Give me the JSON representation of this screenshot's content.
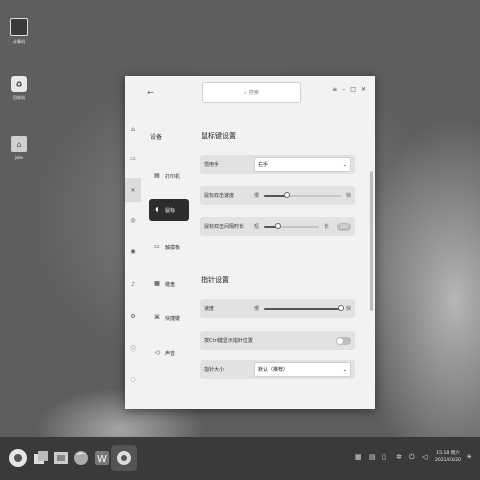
{
  "desktop": {
    "icons": [
      {
        "name": "computer",
        "label": "计算机"
      },
      {
        "name": "trash",
        "label": "回收站"
      },
      {
        "name": "home",
        "label": "jake"
      }
    ]
  },
  "window": {
    "back_icon": "←",
    "search_placeholder": "搜索",
    "controls": {
      "menu": "≡",
      "minimize": "–",
      "maximize": "□",
      "close": "✕"
    },
    "rail_icons": [
      "home-icon",
      "display-icon",
      "tool-icon",
      "globe-icon",
      "user-icon",
      "bell-icon",
      "gear-icon",
      "info-icon"
    ],
    "category_header": "设备",
    "categories": [
      {
        "label": "打印机",
        "icon": "printer-icon",
        "glyph": "▤"
      },
      {
        "label": "鼠标",
        "icon": "mouse-icon",
        "glyph": "◖",
        "active": true
      },
      {
        "label": "触摸板",
        "icon": "touchpad-icon",
        "glyph": "▭"
      },
      {
        "label": "键盘",
        "icon": "keyboard-icon",
        "glyph": "▦"
      },
      {
        "label": "快捷键",
        "icon": "shortcut-icon",
        "glyph": "⌘"
      },
      {
        "label": "声音",
        "icon": "sound-icon",
        "glyph": "◁"
      }
    ],
    "mouse_section": {
      "title": "鼠标键设置",
      "handedness_label": "惯用手",
      "handedness_value": "右手",
      "dblclick_speed_label": "鼠标双击速度",
      "dblclick_speed_min": "慢",
      "dblclick_speed_max": "快",
      "dblclick_speed_value": 0.3,
      "dblclick_interval_label": "鼠标双击间隔时长",
      "dblclick_interval_min": "短",
      "dblclick_interval_max": "长",
      "dblclick_interval_value": 0.25,
      "test_button": "100"
    },
    "pointer_section": {
      "title": "指针设置",
      "speed_label": "速度",
      "speed_min": "慢",
      "speed_max": "快",
      "speed_value": 1.0,
      "ctrl_label": "按Ctrl键显示指针位置",
      "ctrl_enabled": false,
      "size_label": "指针大小",
      "size_value": "默认（推荐）"
    }
  },
  "taskbar": {
    "apps": [
      "start-menu-icon",
      "multitask-icon",
      "file-manager-icon",
      "firefox-icon",
      "wps-icon",
      "settings-icon"
    ],
    "tray": [
      "keyboard-icon",
      "clipboard-icon",
      "battery-icon",
      "brightness-icon",
      "power-icon",
      "volume-icon",
      "notification-icon"
    ],
    "clock_time": "15:18 周六",
    "clock_date": "2021/03/20"
  }
}
